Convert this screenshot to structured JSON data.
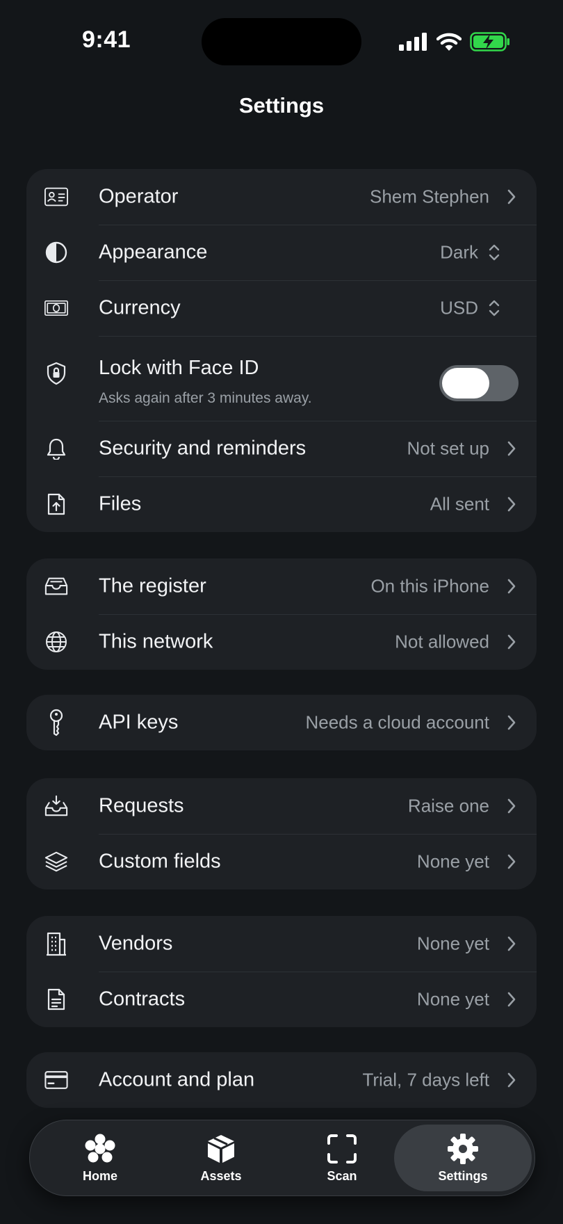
{
  "status": {
    "time": "9:41"
  },
  "header": {
    "title": "Settings"
  },
  "groups": [
    {
      "rows": [
        {
          "icon": "id-card-icon",
          "label": "Operator",
          "value": "Shem Stephen"
        },
        {
          "icon": "contrast-icon",
          "label": "Appearance",
          "value": "Dark"
        },
        {
          "icon": "banknote-icon",
          "label": "Currency",
          "value": "USD"
        },
        {
          "icon": "shield-lock-icon",
          "label": "Lock with Face ID",
          "subtitle": "Asks again after 3 minutes away.",
          "toggle_on": true
        },
        {
          "icon": "bell-icon",
          "label": "Security and reminders",
          "value": "Not set up"
        },
        {
          "icon": "file-upload-icon",
          "label": "Files",
          "value": "All sent"
        }
      ]
    },
    {
      "rows": [
        {
          "icon": "inbox-icon",
          "label": "The register",
          "value": "On this iPhone"
        },
        {
          "icon": "globe-icon",
          "label": "This network",
          "value": "Not allowed"
        }
      ]
    },
    {
      "rows": [
        {
          "icon": "key-icon",
          "label": "API keys",
          "value": "Needs a cloud account"
        }
      ]
    },
    {
      "rows": [
        {
          "icon": "inbox-download-icon",
          "label": "Requests",
          "value": "Raise one"
        },
        {
          "icon": "layers-icon",
          "label": "Custom fields",
          "value": "None yet"
        }
      ]
    },
    {
      "rows": [
        {
          "icon": "building-icon",
          "label": "Vendors",
          "value": "None yet"
        },
        {
          "icon": "document-icon",
          "label": "Contracts",
          "value": "None yet"
        }
      ]
    },
    {
      "rows": [
        {
          "icon": "credit-card-icon",
          "label": "Account and plan",
          "value": "Trial, 7 days left"
        }
      ]
    }
  ],
  "tabbar": {
    "tabs": [
      {
        "label": "Home",
        "icon": "flower-icon"
      },
      {
        "label": "Assets",
        "icon": "box-icon"
      },
      {
        "label": "Scan",
        "icon": "scan-frame-icon"
      },
      {
        "label": "Settings",
        "icon": "gear-icon"
      }
    ],
    "active": "Settings"
  },
  "colors": {
    "background": "#131619",
    "card": "#1e2125",
    "secondary_text": "#9aa0a6",
    "battery_green": "#32d74b"
  }
}
